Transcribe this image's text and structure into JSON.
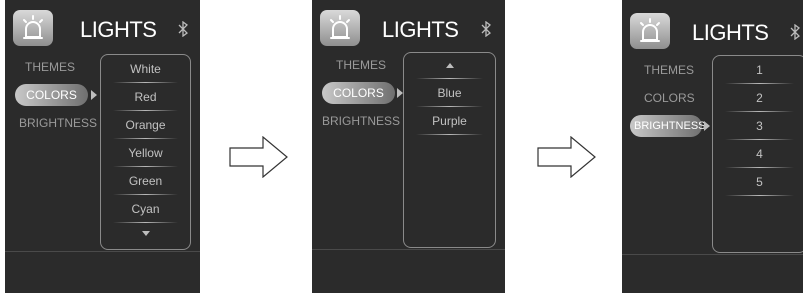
{
  "title": "LIGHTS",
  "menu": {
    "themes": "THEMES",
    "colors": "COLORS",
    "brightness": "BRIGHTNESS"
  },
  "screen1": {
    "options": [
      "White",
      "Red",
      "Orange",
      "Yellow",
      "Green",
      "Cyan"
    ]
  },
  "screen2": {
    "options": [
      "Blue",
      "Purple"
    ]
  },
  "screen3": {
    "options": [
      "1",
      "2",
      "3",
      "4",
      "5"
    ]
  },
  "icons": {
    "app": "light-alarm-icon",
    "status": "bluetooth-icon",
    "transition": "right-arrow-icon"
  },
  "colors": {
    "screen_bg": "#2b2b2b",
    "text": "#ffffff",
    "muted": "#9a9a9a"
  }
}
